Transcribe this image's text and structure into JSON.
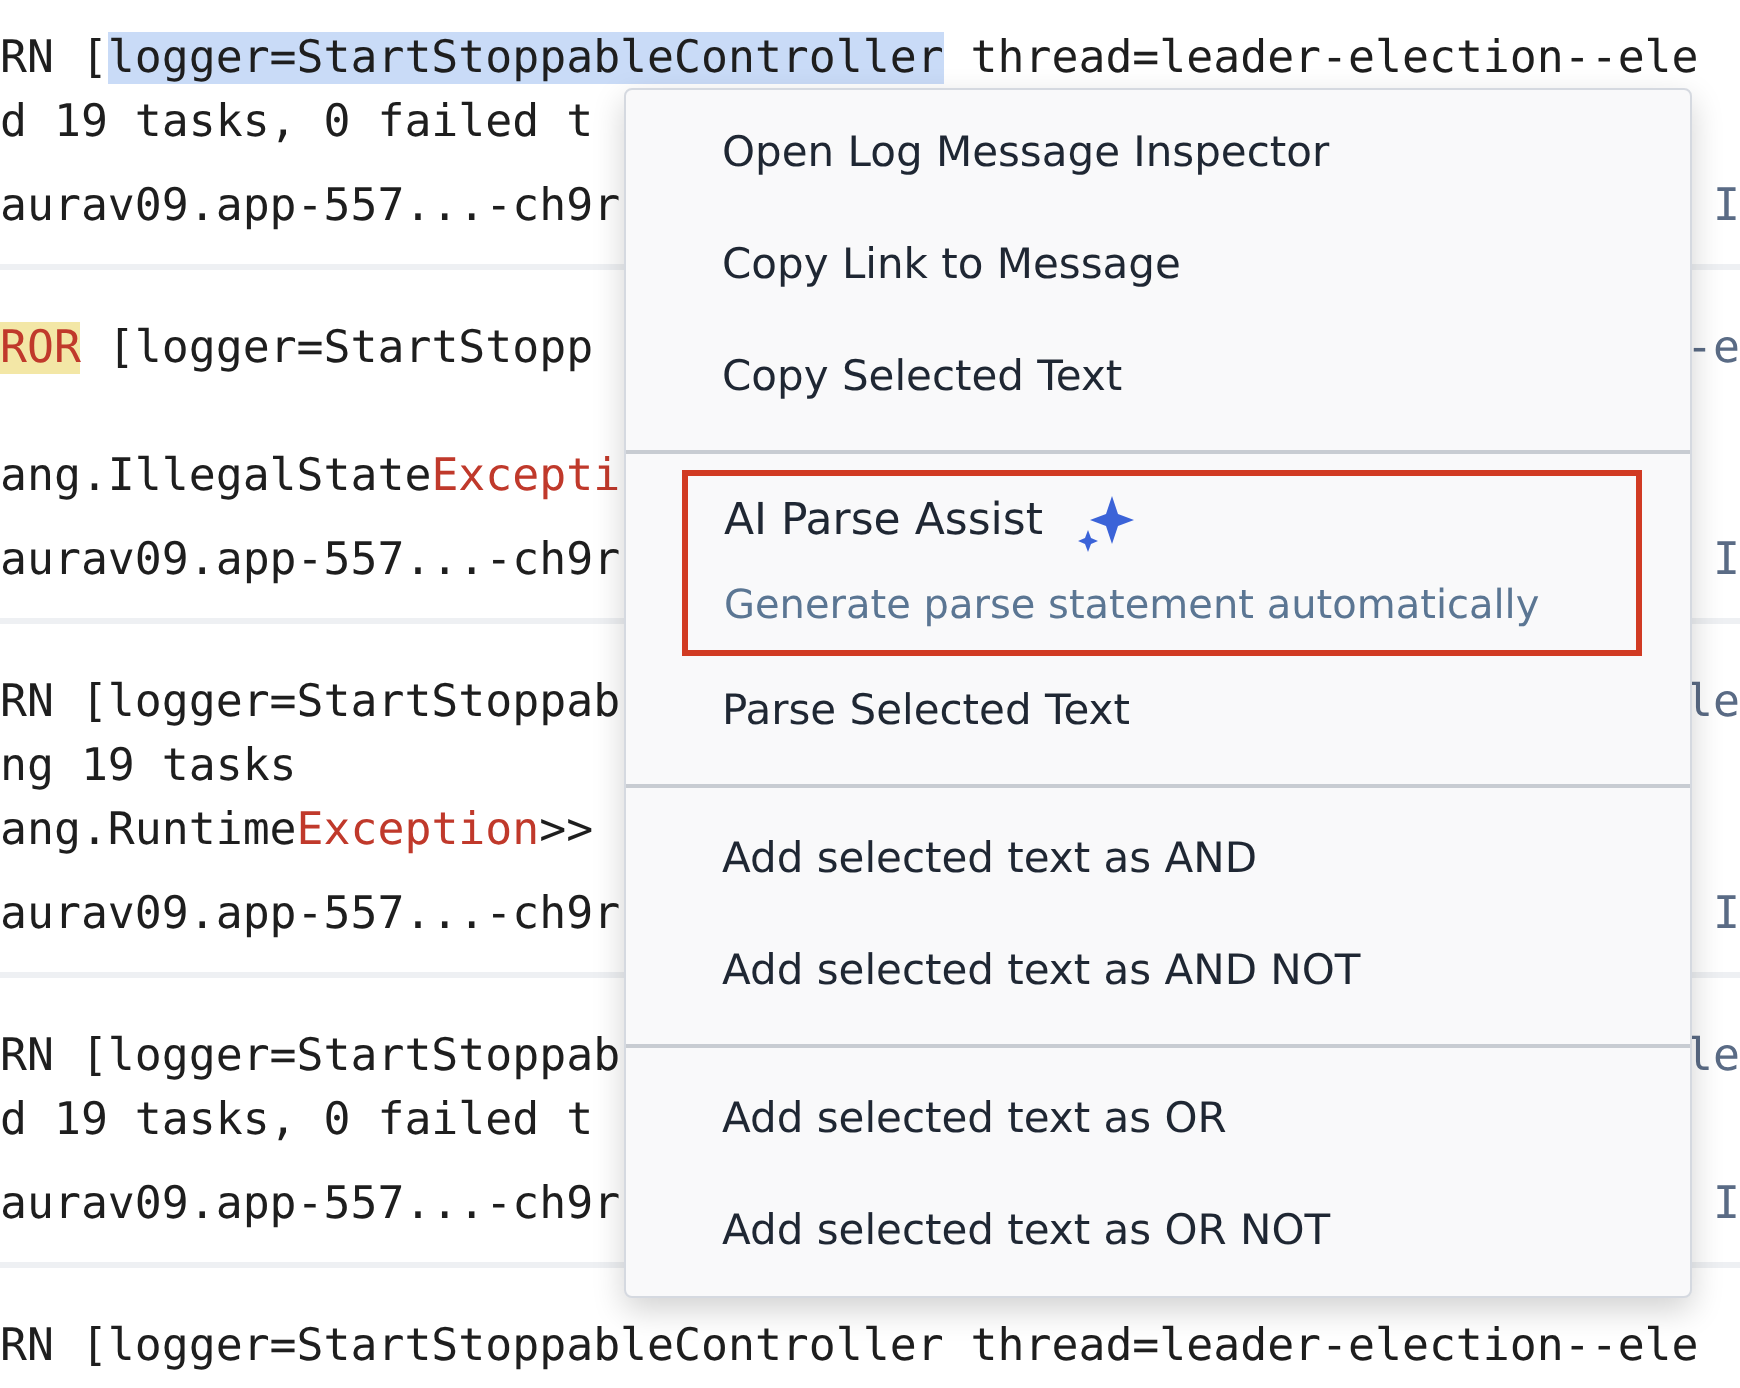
{
  "log_rows": [
    {
      "lines": [
        {
          "segments": [
            {
              "text": "RN [",
              "kind": "plain"
            },
            {
              "text": "logger=StartStoppableController",
              "kind": "selection"
            },
            {
              "text": " thread=leader-election--ele",
              "kind": "plain"
            }
          ]
        },
        {
          "segments": [
            {
              "text": "d 19 tasks, 0 failed t",
              "kind": "plain"
            }
          ]
        },
        {
          "segments": [
            {
              "text": "aurav09.app-557...-ch9r",
              "kind": "plain"
            }
          ],
          "right": "I"
        }
      ]
    },
    {
      "lines": [
        {
          "segments": [
            {
              "text": "ROR",
              "kind": "level"
            },
            {
              "text": " [logger=StartStopp",
              "kind": "plain"
            }
          ],
          "right": "-e"
        },
        {
          "blank_before": true,
          "segments": [
            {
              "text": "ang.IllegalState",
              "kind": "plain"
            },
            {
              "text": "Excepti",
              "kind": "exception"
            }
          ]
        },
        {
          "segments": [
            {
              "text": "aurav09.app-557...-ch9r",
              "kind": "plain"
            }
          ],
          "right": "I"
        }
      ]
    },
    {
      "lines": [
        {
          "segments": [
            {
              "text": "RN [logger=StartStoppab",
              "kind": "plain"
            }
          ],
          "right": "le"
        },
        {
          "segments": [
            {
              "text": "ng 19 tasks",
              "kind": "plain"
            }
          ]
        },
        {
          "segments": [
            {
              "text": "ang.Runtime",
              "kind": "plain"
            },
            {
              "text": "Exception",
              "kind": "exception"
            },
            {
              "text": ">>",
              "kind": "plain"
            }
          ]
        },
        {
          "segments": [
            {
              "text": "aurav09.app-557...-ch9r",
              "kind": "plain"
            }
          ],
          "right": "I"
        }
      ]
    },
    {
      "lines": [
        {
          "segments": [
            {
              "text": "RN [logger=StartStoppab",
              "kind": "plain"
            }
          ],
          "right": "le"
        },
        {
          "segments": [
            {
              "text": "d 19 tasks, 0 failed t",
              "kind": "plain"
            }
          ]
        },
        {
          "segments": [
            {
              "text": "aurav09.app-557...-ch9r",
              "kind": "plain"
            }
          ],
          "right": "I"
        }
      ]
    },
    {
      "lines": [
        {
          "segments": [
            {
              "text": "RN [logger=StartStoppableController thread=leader-election--ele",
              "kind": "plain"
            }
          ]
        }
      ]
    }
  ],
  "context_menu": {
    "sections": [
      {
        "items": [
          {
            "kind": "plain",
            "label": "Open Log Message Inspector"
          },
          {
            "kind": "plain",
            "label": "Copy Link to Message"
          },
          {
            "kind": "plain",
            "label": "Copy Selected Text"
          }
        ]
      },
      {
        "items": [
          {
            "kind": "ai",
            "label": "AI Parse Assist",
            "description": "Generate parse statement automatically",
            "highlighted": true
          },
          {
            "kind": "plain",
            "label": "Parse Selected Text"
          }
        ]
      },
      {
        "items": [
          {
            "kind": "plain",
            "label": "Add selected text as AND"
          },
          {
            "kind": "plain",
            "label": "Add selected text as AND NOT"
          }
        ]
      },
      {
        "items": [
          {
            "kind": "plain",
            "label": "Add selected text as OR"
          },
          {
            "kind": "plain",
            "label": "Add selected text as OR NOT"
          }
        ]
      }
    ]
  }
}
